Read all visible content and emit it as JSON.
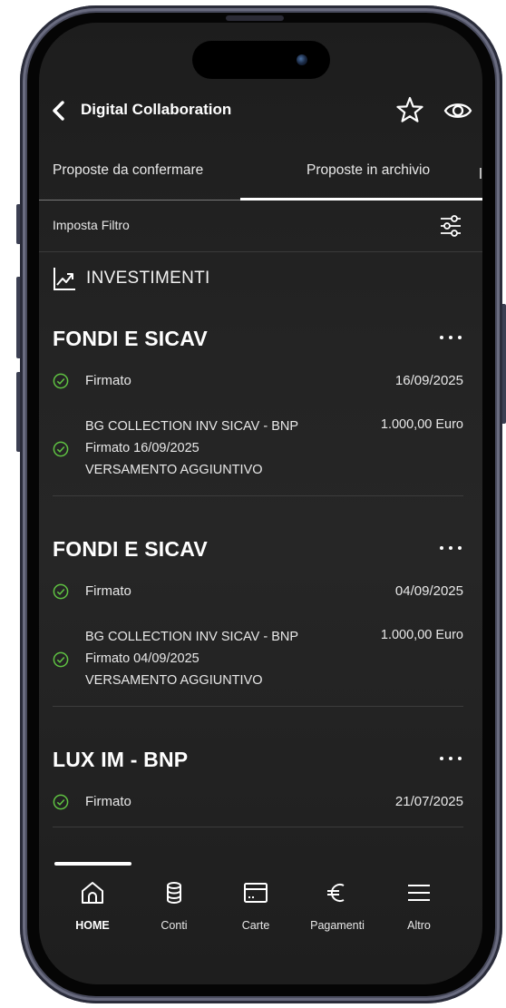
{
  "header": {
    "title": "Digital Collaboration"
  },
  "tabs": [
    {
      "label": "Proposte da confermare",
      "active": false
    },
    {
      "label": "Proposte in archivio",
      "active": true
    }
  ],
  "filter": {
    "label": "Imposta Filtro"
  },
  "section": {
    "label": "INVESTIMENTI"
  },
  "cards": [
    {
      "title": "FONDI E SICAV",
      "status": "Firmato",
      "date": "16/09/2025",
      "detail": {
        "fund": "BG COLLECTION INV SICAV - BNP",
        "signed": "Firmato 16/09/2025",
        "type": "VERSAMENTO AGGIUNTIVO",
        "amount": "1.000,00 Euro"
      }
    },
    {
      "title": "FONDI E SICAV",
      "status": "Firmato",
      "date": "04/09/2025",
      "detail": {
        "fund": "BG COLLECTION INV SICAV - BNP",
        "signed": "Firmato 04/09/2025",
        "type": "VERSAMENTO AGGIUNTIVO",
        "amount": "1.000,00 Euro"
      }
    },
    {
      "title": "LUX IM - BNP",
      "status": "Firmato",
      "date": "21/07/2025"
    }
  ],
  "bottom_nav": [
    {
      "label": "HOME",
      "icon": "home-icon",
      "active": true
    },
    {
      "label": "Conti",
      "icon": "database-icon",
      "active": false
    },
    {
      "label": "Carte",
      "icon": "card-icon",
      "active": false
    },
    {
      "label": "Pagamenti",
      "icon": "euro-icon",
      "active": false
    },
    {
      "label": "Altro",
      "icon": "menu-icon",
      "active": false
    }
  ],
  "colors": {
    "check": "#5fc242",
    "background": "#222222",
    "text": "#ffffff"
  }
}
